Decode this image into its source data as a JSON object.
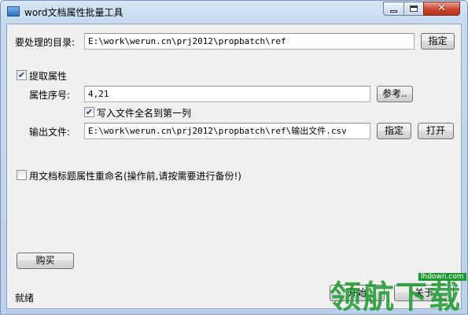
{
  "window": {
    "title": "word文档属性批量工具"
  },
  "dir": {
    "label": "要处理的目录:",
    "value": "E:\\work\\werun.cn\\prj2012\\propbatch\\ref",
    "browse": "指定"
  },
  "extract": {
    "checkbox_label": "提取属性",
    "checked": true,
    "index_label": "属性序号:",
    "index_value": "4,21",
    "ref_button": "参考..",
    "writename_label": "写入文件全名到第一列",
    "writename_checked": true,
    "output_label": "输出文件:",
    "output_value": "E:\\work\\werun.cn\\prj2012\\propbatch\\ref\\输出文件.csv",
    "output_browse": "指定",
    "output_open": "打开"
  },
  "rename": {
    "checkbox_label": "用文档标题属性重命名(操作前,请按需要进行备份!)",
    "checked": false
  },
  "buy_button": "购买",
  "status": "就绪",
  "start_button": "开始",
  "close_button": "关于",
  "watermark": {
    "text": "领航下载",
    "url": "lhdown.com"
  }
}
